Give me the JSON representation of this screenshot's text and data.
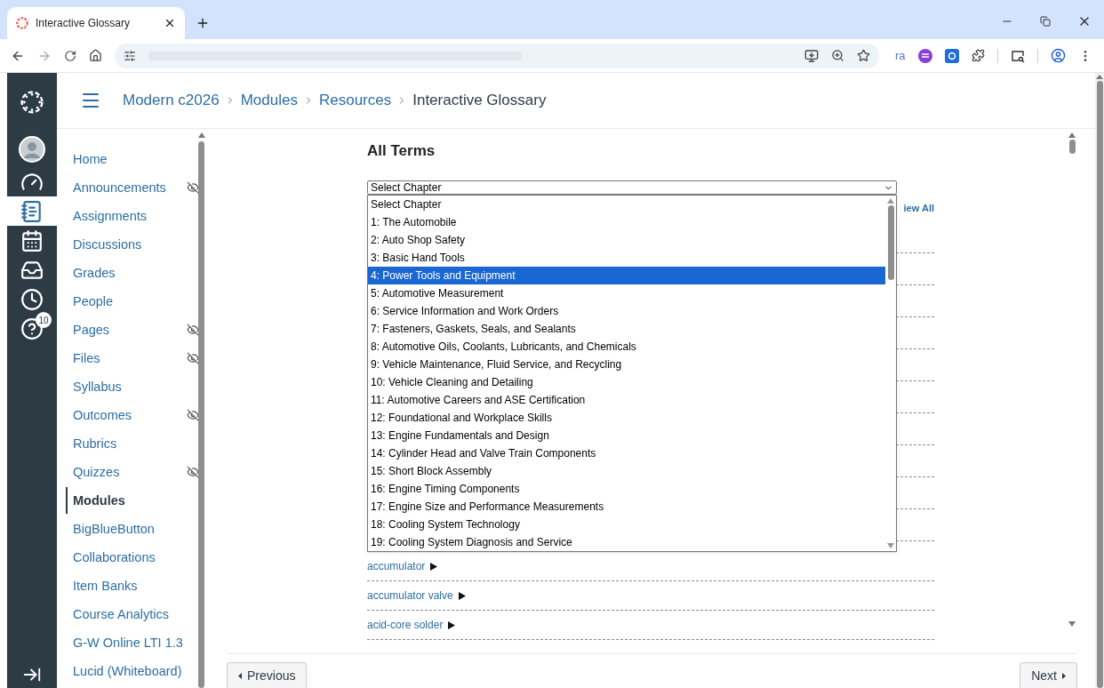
{
  "browser": {
    "tab_title": "Interactive Glossary",
    "extension_label": "ra"
  },
  "global_nav": {
    "items": [
      {
        "kind": "account",
        "selected": false
      },
      {
        "kind": "dashboard",
        "selected": false
      },
      {
        "kind": "courses",
        "selected": true
      },
      {
        "kind": "calendar",
        "selected": false
      },
      {
        "kind": "inbox",
        "selected": false
      },
      {
        "kind": "history",
        "selected": false
      },
      {
        "kind": "help",
        "selected": false,
        "badge": "10"
      }
    ]
  },
  "breadcrumb": [
    "Modern c2026",
    "Modules",
    "Resources",
    "Interactive Glossary"
  ],
  "course_nav": [
    {
      "label": "Home",
      "hidden": false,
      "selected": false
    },
    {
      "label": "Announcements",
      "hidden": true,
      "selected": false
    },
    {
      "label": "Assignments",
      "hidden": false,
      "selected": false
    },
    {
      "label": "Discussions",
      "hidden": false,
      "selected": false
    },
    {
      "label": "Grades",
      "hidden": false,
      "selected": false
    },
    {
      "label": "People",
      "hidden": false,
      "selected": false
    },
    {
      "label": "Pages",
      "hidden": true,
      "selected": false
    },
    {
      "label": "Files",
      "hidden": true,
      "selected": false
    },
    {
      "label": "Syllabus",
      "hidden": false,
      "selected": false
    },
    {
      "label": "Outcomes",
      "hidden": true,
      "selected": false
    },
    {
      "label": "Rubrics",
      "hidden": false,
      "selected": false
    },
    {
      "label": "Quizzes",
      "hidden": true,
      "selected": false
    },
    {
      "label": "Modules",
      "hidden": false,
      "selected": true
    },
    {
      "label": "BigBlueButton",
      "hidden": false,
      "selected": false
    },
    {
      "label": "Collaborations",
      "hidden": false,
      "selected": false
    },
    {
      "label": "Item Banks",
      "hidden": false,
      "selected": false
    },
    {
      "label": "Course Analytics",
      "hidden": false,
      "selected": false
    },
    {
      "label": "G-W Online LTI 1.3",
      "hidden": false,
      "selected": false
    },
    {
      "label": "Lucid (Whiteboard)",
      "hidden": false,
      "selected": false
    }
  ],
  "glossary": {
    "heading": "All Terms",
    "chapter_select": {
      "value": "Select Chapter",
      "options": [
        {
          "label": "Select Chapter",
          "highlighted": false
        },
        {
          "label": "1: The Automobile",
          "highlighted": false
        },
        {
          "label": "2: Auto Shop Safety",
          "highlighted": false
        },
        {
          "label": "3: Basic Hand Tools",
          "highlighted": false
        },
        {
          "label": "4: Power Tools and Equipment",
          "highlighted": true
        },
        {
          "label": "5: Automotive Measurement",
          "highlighted": false
        },
        {
          "label": "6: Service Information and Work Orders",
          "highlighted": false
        },
        {
          "label": "7: Fasteners, Gaskets, Seals, and Sealants",
          "highlighted": false
        },
        {
          "label": "8: Automotive Oils, Coolants, Lubricants, and Chemicals",
          "highlighted": false
        },
        {
          "label": "9: Vehicle Maintenance, Fluid Service, and Recycling",
          "highlighted": false
        },
        {
          "label": "10: Vehicle Cleaning and Detailing",
          "highlighted": false
        },
        {
          "label": "11: Automotive Careers and ASE Certification",
          "highlighted": false
        },
        {
          "label": "12: Foundational and Workplace Skills",
          "highlighted": false
        },
        {
          "label": "13: Engine Fundamentals and Design",
          "highlighted": false
        },
        {
          "label": "14: Cylinder Head and Valve Train Components",
          "highlighted": false
        },
        {
          "label": "15: Short Block Assembly",
          "highlighted": false
        },
        {
          "label": "16: Engine Timing Components",
          "highlighted": false
        },
        {
          "label": "17: Engine Size and Performance Measurements",
          "highlighted": false
        },
        {
          "label": "18: Cooling System Technology",
          "highlighted": false
        },
        {
          "label": "19: Cooling System Diagnosis and Service",
          "highlighted": false
        }
      ]
    },
    "view_all": "iew All",
    "terms": [
      "accumulator",
      "accumulator valve",
      "acid-core solder"
    ]
  },
  "pager": {
    "previous": "Previous",
    "next": "Next"
  }
}
